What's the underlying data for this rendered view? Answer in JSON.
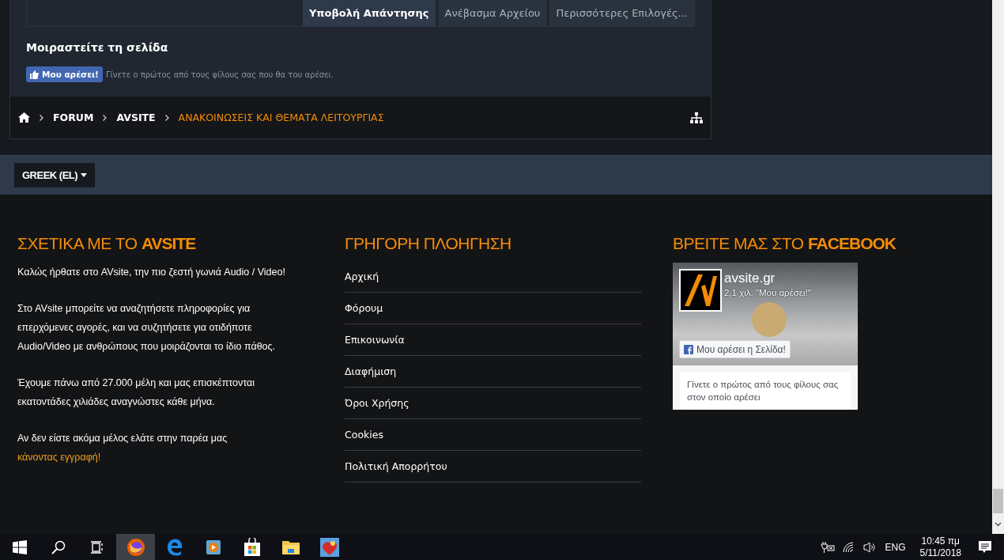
{
  "editor_buttons": [
    {
      "label": "Υποβολή Απάντησης",
      "kind": "primary"
    },
    {
      "label": "Ανέβασμα Αρχείου",
      "kind": "secondary"
    },
    {
      "label": "Περισσότερες Επιλογές...",
      "kind": "secondary"
    }
  ],
  "share": {
    "title": "Μοιραστείτε τη σελίδα",
    "like_button": "Μου αρέσει!",
    "like_text": "Γίνετε ο πρώτος από τους φίλους σας που θα του αρέσει."
  },
  "breadcrumb": [
    {
      "label": "FORUM",
      "current": false
    },
    {
      "label": "AVSITE",
      "current": false
    },
    {
      "label": "ΑΝΑΚΟΙΝΩΣΕΙΣ ΚΑΙ ΘΕΜΑΤΑ ΛΕΙΤΟΥΡΓΙΑΣ",
      "current": true
    }
  ],
  "language": "GREEK (EL)",
  "about": {
    "title": "ΣΧΕΤΙΚΑ ΜΕ ΤΟ **AVSITE**",
    "paragraphs": [
      {
        "text": "Καλώς ήρθατε στο AVsite, την πιο ζεστή γωνιά Audio / Video!"
      },
      {
        "text": "Στο AVsite μπορείτε να αναζητήσετε πληροφορίες για επερχόμενες αγορές, και να συζητήσετε για οτιδήποτε Audio/Video με ανθρώπους που μοιράζονται το ίδιο πάθος."
      },
      {
        "text": "Έχουμε πάνω από 27.000 μέλη και μας επισκέπτονται εκατοντάδες χιλιάδες αναγνώστες κάθε μήνα."
      },
      {
        "text": "Αν δεν είστε ακόμα μέλος ελάτε στην παρέα μας ",
        "link": "κάνοντας εγγραφή!"
      }
    ]
  },
  "navigation": {
    "title": "ΓΡΗΓΟΡΗ ΠΛΟΗΓΗΣΗ",
    "links": [
      "Αρχική",
      "Φόρουμ",
      "Επικοινωνία",
      "Διαφήμιση",
      "Όροι Χρήσης",
      "Cookies",
      "Πολιτική Απορρήτου"
    ]
  },
  "facebook": {
    "title": "ΒΡΕΙΤΕ ΜΑΣ ΣΤΟ **FACEBOOK**",
    "page_name": "avsite.gr",
    "likes": "2,1 χιλ. \"Μου αρέσει!\"",
    "like_page_button": "Μου αρέσει η Σελίδα!",
    "friends_text": "Γίνετε ο πρώτος από τους φίλους σας στον οποίο αρέσει"
  },
  "taskbar": {
    "apps": [
      {
        "kind": "start",
        "selected": false
      },
      {
        "kind": "search",
        "selected": false
      },
      {
        "kind": "taskview",
        "selected": false
      },
      {
        "kind": "firefox",
        "selected": true
      },
      {
        "kind": "edge",
        "selected": false
      },
      {
        "kind": "media",
        "selected": false
      },
      {
        "kind": "store",
        "selected": false
      },
      {
        "kind": "explorer",
        "selected": false
      },
      {
        "kind": "game",
        "selected": false
      }
    ],
    "language": "ENG",
    "time": "10:45 πμ",
    "date": "5/11/2018"
  }
}
